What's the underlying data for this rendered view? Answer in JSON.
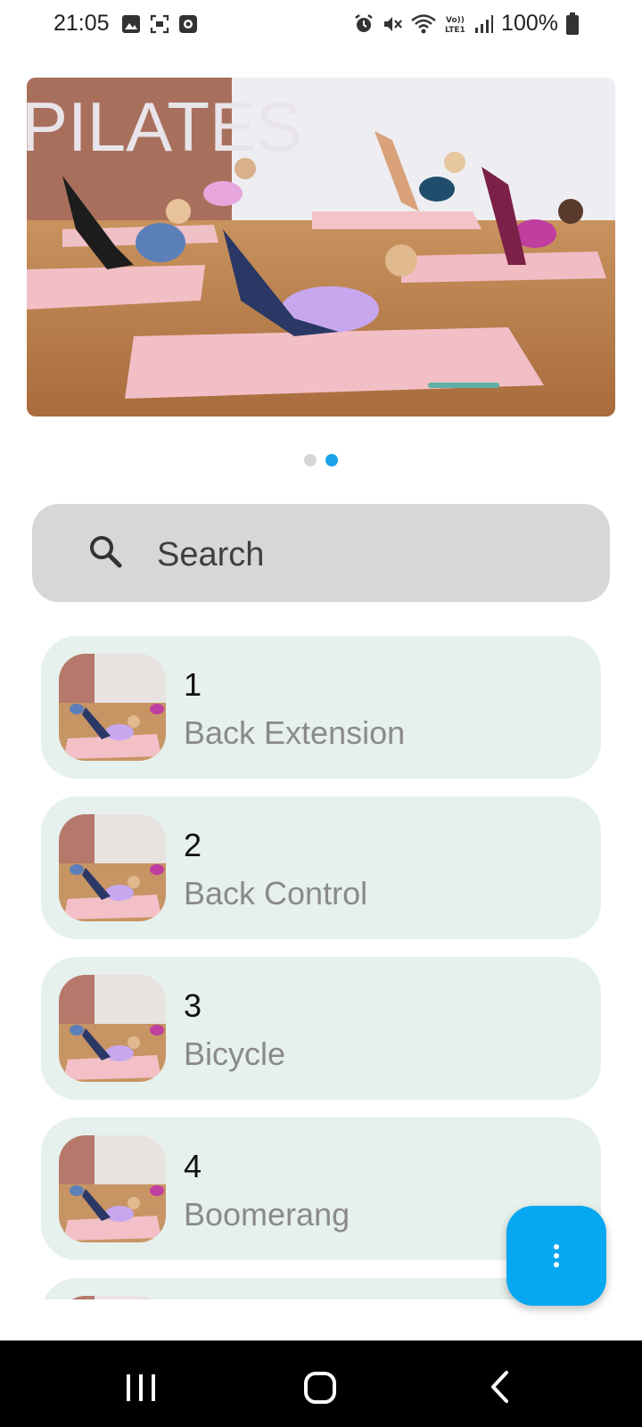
{
  "status_bar": {
    "time": "21:05",
    "battery": "100%",
    "left_icons": [
      "image-icon",
      "screenshot-icon",
      "app-notification-icon"
    ],
    "right_icons": [
      "alarm-icon",
      "mute-icon",
      "wifi-icon",
      "volte-icon",
      "signal-icon",
      "battery-icon"
    ]
  },
  "banner": {
    "text": "PILATES",
    "page_count": 2,
    "active_page": 2
  },
  "search": {
    "placeholder": "Search"
  },
  "exercises": [
    {
      "number": "1",
      "name": "Back Extension"
    },
    {
      "number": "2",
      "name": "Back Control"
    },
    {
      "number": "3",
      "name": "Bicycle"
    },
    {
      "number": "4",
      "name": "Boomerang"
    }
  ],
  "fab": {
    "icon": "more-vertical-icon"
  },
  "colors": {
    "accent": "#06a7f1",
    "list_item_bg": "#e6f0ec",
    "search_bg": "#d9d6d6"
  }
}
